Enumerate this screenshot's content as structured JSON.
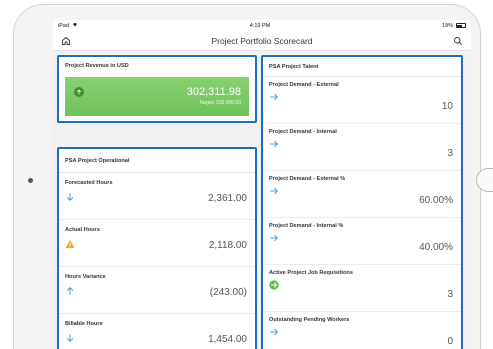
{
  "status_bar": {
    "device": "iPad",
    "time": "4:19 PM",
    "battery": "19%"
  },
  "nav": {
    "title": "Project Portfolio Scorecard",
    "home_icon": "home-icon",
    "search_icon": "search-icon"
  },
  "revenue": {
    "title": "Project Revenue in USD",
    "value": "302,311.98",
    "target": "Target: 310,000.00",
    "icon": "up-arrow-circle-icon",
    "color": "#7dc965"
  },
  "operational": {
    "title": "PSA Project Operational",
    "metrics": [
      {
        "label": "Forecasted Hours",
        "value": "2,361.00",
        "icon": "arrow-down-icon"
      },
      {
        "label": "Actual Hours",
        "value": "2,118.00",
        "icon": "warning-triangle-icon"
      },
      {
        "label": "Hours Variance",
        "value": "(243.00)",
        "icon": "arrow-up-icon"
      },
      {
        "label": "Billable Hours",
        "value": "1,454.00",
        "icon": "arrow-down-icon"
      }
    ]
  },
  "talent": {
    "title": "PSA Project Talent",
    "metrics": [
      {
        "label": "Project Demand - External",
        "value": "10",
        "icon": "arrow-right-icon"
      },
      {
        "label": "Project Demand - Internal",
        "value": "3",
        "icon": "arrow-right-icon"
      },
      {
        "label": "Project Demand - External %",
        "value": "60.00%",
        "icon": "arrow-right-icon"
      },
      {
        "label": "Project Demand - Internal %",
        "value": "40.00%",
        "icon": "arrow-right-icon"
      },
      {
        "label": "Active Project Job Requisitions",
        "value": "3",
        "icon": "arrow-right-circle-icon"
      },
      {
        "label": "Outstanding Pending Workers",
        "value": "0",
        "icon": "arrow-right-icon"
      }
    ]
  },
  "colors": {
    "accent": "#1a6fbf",
    "arrow": "#3aa0e0",
    "warning": "#f5a623",
    "good": "#5cb848"
  }
}
